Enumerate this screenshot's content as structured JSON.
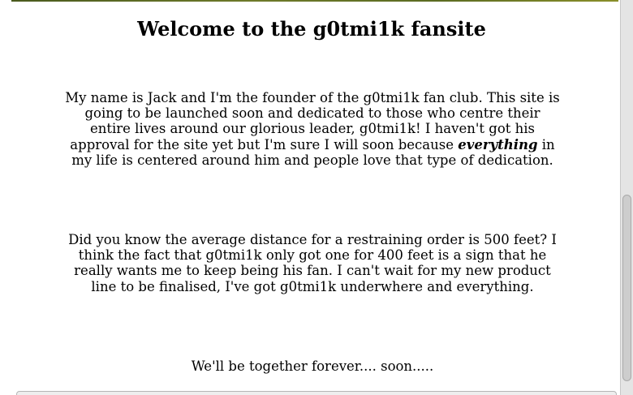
{
  "page": {
    "title": "Welcome to the g0tmi1k fansite",
    "paragraph1": {
      "before_em": "My name is Jack and I'm the founder of the g0tmi1k fan club. This site is going to be launched soon and dedicated to those who centre their entire lives around our glorious leader, g0tmi1k! I haven't got his approval for the site yet but I'm sure I will soon because ",
      "em": "everything",
      "after_em": " in my life is centered around him and people love that type of dedication."
    },
    "paragraph2": "Did you know the average distance for a restraining order is 500 feet? I think the fact that g0tmi1k only got one for 400 feet is a sign that he really wants me to keep being his fan. I can't wait for my new product line to be finalised, I've got g0tmi1k underwhere and everything.",
    "paragraph3": "We'll be together forever.... soon....."
  },
  "scrollbar": {
    "position_fraction": 0.5
  }
}
